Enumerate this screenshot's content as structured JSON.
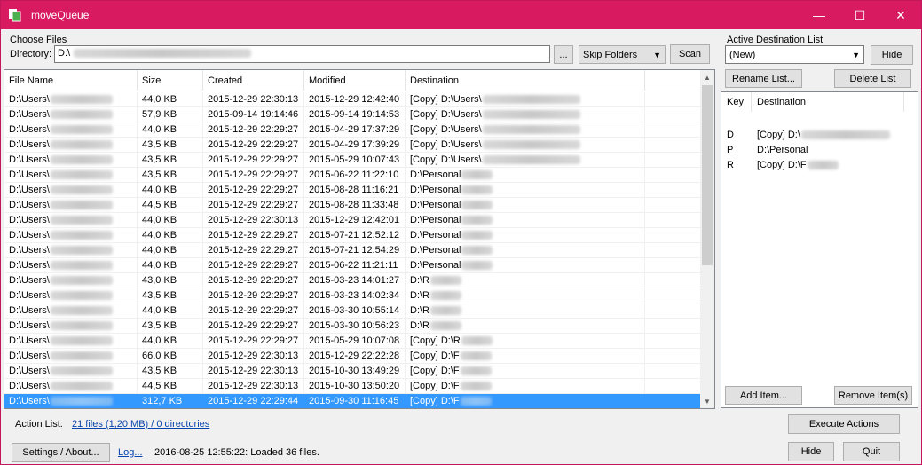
{
  "window": {
    "title": "moveQueue",
    "minimize": "—",
    "maximize": "☐",
    "close": "✕"
  },
  "choose_files": {
    "group_label": "Choose Files",
    "directory_label": "Directory:",
    "directory_value": "D:\\",
    "browse_label": "...",
    "skip_folders": "Skip Folders",
    "scan_label": "Scan"
  },
  "file_list": {
    "columns": [
      "File Name",
      "Size",
      "Created",
      "Modified",
      "Destination"
    ],
    "rows": [
      {
        "name": "D:\\Users\\",
        "size": "44,0 KB",
        "created": "2015-12-29  22:30:13",
        "modified": "2015-12-29  12:42:40",
        "dest": "[Copy] D:\\Users\\"
      },
      {
        "name": "D:\\Users\\",
        "size": "57,9 KB",
        "created": "2015-09-14  19:14:46",
        "modified": "2015-09-14  19:14:53",
        "dest": "[Copy] D:\\Users\\"
      },
      {
        "name": "D:\\Users\\",
        "size": "44,0 KB",
        "created": "2015-12-29  22:29:27",
        "modified": "2015-04-29  17:37:29",
        "dest": "[Copy] D:\\Users\\"
      },
      {
        "name": "D:\\Users\\",
        "size": "43,5 KB",
        "created": "2015-12-29  22:29:27",
        "modified": "2015-04-29  17:39:29",
        "dest": "[Copy] D:\\Users\\"
      },
      {
        "name": "D:\\Users\\",
        "size": "43,5 KB",
        "created": "2015-12-29  22:29:27",
        "modified": "2015-05-29  10:07:43",
        "dest": "[Copy] D:\\Users\\"
      },
      {
        "name": "D:\\Users\\",
        "size": "43,5 KB",
        "created": "2015-12-29  22:29:27",
        "modified": "2015-06-22  11:22:10",
        "dest": "D:\\Personal"
      },
      {
        "name": "D:\\Users\\",
        "size": "44,0 KB",
        "created": "2015-12-29  22:29:27",
        "modified": "2015-08-28  11:16:21",
        "dest": "D:\\Personal"
      },
      {
        "name": "D:\\Users\\",
        "size": "44,5 KB",
        "created": "2015-12-29  22:29:27",
        "modified": "2015-08-28  11:33:48",
        "dest": "D:\\Personal"
      },
      {
        "name": "D:\\Users\\",
        "size": "44,0 KB",
        "created": "2015-12-29  22:30:13",
        "modified": "2015-12-29  12:42:01",
        "dest": "D:\\Personal"
      },
      {
        "name": "D:\\Users\\",
        "size": "44,0 KB",
        "created": "2015-12-29  22:29:27",
        "modified": "2015-07-21  12:52:12",
        "dest": "D:\\Personal"
      },
      {
        "name": "D:\\Users\\",
        "size": "44,0 KB",
        "created": "2015-12-29  22:29:27",
        "modified": "2015-07-21  12:54:29",
        "dest": "D:\\Personal"
      },
      {
        "name": "D:\\Users\\",
        "size": "44,0 KB",
        "created": "2015-12-29  22:29:27",
        "modified": "2015-06-22  11:21:11",
        "dest": "D:\\Personal"
      },
      {
        "name": "D:\\Users\\",
        "size": "43,0 KB",
        "created": "2015-12-29  22:29:27",
        "modified": "2015-03-23  14:01:27",
        "dest": "D:\\R"
      },
      {
        "name": "D:\\Users\\",
        "size": "43,5 KB",
        "created": "2015-12-29  22:29:27",
        "modified": "2015-03-23  14:02:34",
        "dest": "D:\\R"
      },
      {
        "name": "D:\\Users\\",
        "size": "44,0 KB",
        "created": "2015-12-29  22:29:27",
        "modified": "2015-03-30  10:55:14",
        "dest": "D:\\R"
      },
      {
        "name": "D:\\Users\\",
        "size": "43,5 KB",
        "created": "2015-12-29  22:29:27",
        "modified": "2015-03-30  10:56:23",
        "dest": "D:\\R"
      },
      {
        "name": "D:\\Users\\",
        "size": "44,0 KB",
        "created": "2015-12-29  22:29:27",
        "modified": "2015-05-29  10:07:08",
        "dest": "[Copy] D:\\R"
      },
      {
        "name": "D:\\Users\\",
        "size": "66,0 KB",
        "created": "2015-12-29  22:30:13",
        "modified": "2015-12-29  22:22:28",
        "dest": "[Copy] D:\\F"
      },
      {
        "name": "D:\\Users\\",
        "size": "43,5 KB",
        "created": "2015-12-29  22:30:13",
        "modified": "2015-10-30  13:49:29",
        "dest": "[Copy] D:\\F"
      },
      {
        "name": "D:\\Users\\",
        "size": "44,5 KB",
        "created": "2015-12-29  22:30:13",
        "modified": "2015-10-30  13:50:20",
        "dest": "[Copy] D:\\F"
      },
      {
        "name": "D:\\Users\\",
        "size": "312,7 KB",
        "created": "2015-12-29  22:29:44",
        "modified": "2015-09-30  11:16:45",
        "dest": "[Copy] D:\\F",
        "selected": true
      }
    ]
  },
  "destinations": {
    "group_label": "Active Destination List",
    "list_select": "(New)",
    "hide_label": "Hide",
    "rename_label": "Rename List...",
    "delete_label": "Delete List",
    "columns": [
      "Key",
      "Destination"
    ],
    "rows": [
      {
        "key": "D",
        "dest": "[Copy] D:\\"
      },
      {
        "key": "P",
        "dest": "D:\\Personal"
      },
      {
        "key": "R",
        "dest": "[Copy] D:\\F"
      }
    ],
    "add_label": "Add Item...",
    "remove_label": "Remove Item(s)"
  },
  "footer": {
    "action_list_label": "Action List:",
    "action_list_link": "21 files (1,20 MB) / 0 directories",
    "execute_label": "Execute Actions",
    "settings_label": "Settings / About...",
    "log_label": "Log...",
    "status_text": "2016-08-25 12:55:22: Loaded 36 files.",
    "hide_label": "Hide",
    "quit_label": "Quit"
  }
}
